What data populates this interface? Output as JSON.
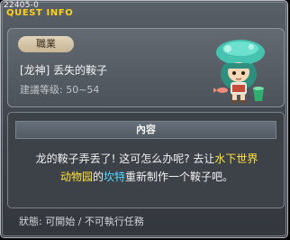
{
  "header": {
    "quest_id": "22405-0",
    "title": "QUEST INFO"
  },
  "quest": {
    "category": "職業",
    "name": "[龙神]  丢失的鞍子",
    "level_label": "建議等级: 50~54"
  },
  "content": {
    "heading": "內容",
    "text_1": "龙的鞍子弄丢了! 这可怎么办呢? 去让",
    "link_1": "水下世界",
    "link_1b": "动物园",
    "text_2": "的",
    "link_2": "坎特",
    "text_3": "重新制作一个鞍子吧。"
  },
  "status": {
    "text": "狀態:  可開始  /  不可執行任務"
  },
  "colors": {
    "title": "#ffd21c",
    "highlight_yellow": "#ffe23c",
    "highlight_cyan": "#4fd8ff"
  },
  "icons": {
    "npc": "npc-mushroom-girl-icon"
  }
}
